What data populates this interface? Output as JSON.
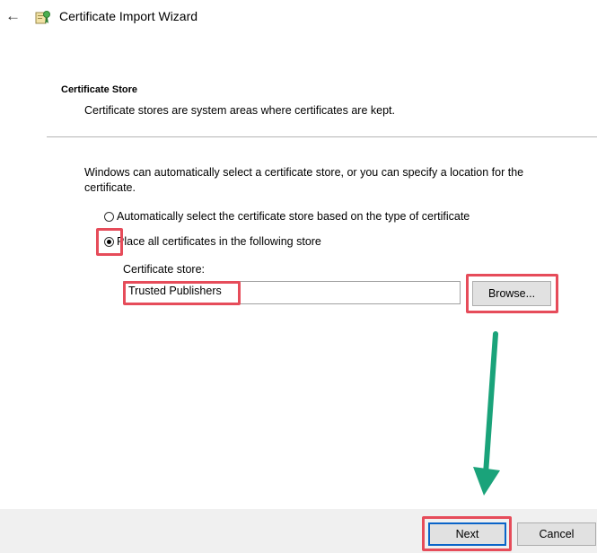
{
  "window": {
    "title": "Certificate Import Wizard",
    "back_icon": "back-arrow-icon",
    "app_icon": "certificate-wizard-icon"
  },
  "page": {
    "heading": "Certificate Store",
    "subheading": "Certificate stores are system areas where certificates are kept.",
    "description": "Windows can automatically select a certificate store, or you can specify a location for the certificate."
  },
  "options": {
    "auto": {
      "label": "Automatically select the certificate store based on the type of certificate",
      "selected": false
    },
    "manual": {
      "label": "Place all certificates in the following store",
      "selected": true
    }
  },
  "store": {
    "label": "Certificate store:",
    "value": "Trusted Publishers"
  },
  "buttons": {
    "browse": "Browse...",
    "next": "Next",
    "cancel": "Cancel"
  },
  "colors": {
    "highlight": "#e64c5a",
    "arrow": "#1aa37a",
    "focus_border": "#0a64c8"
  }
}
